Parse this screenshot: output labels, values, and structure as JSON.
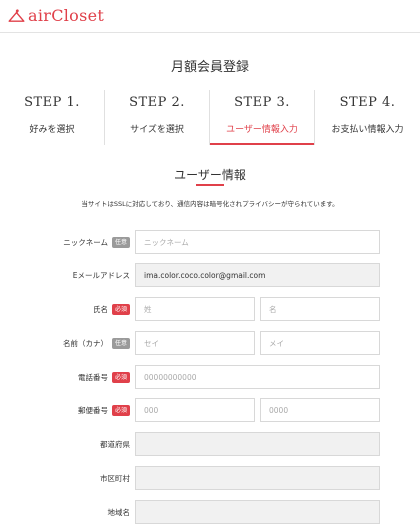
{
  "header": {
    "brand": "airCloset",
    "accent_color": "#e0404a",
    "logo_icon": "hanger-icon"
  },
  "page_title": "月額会員登録",
  "steps": [
    {
      "num": "STEP 1.",
      "label": "好みを選択",
      "active": false
    },
    {
      "num": "STEP 2.",
      "label": "サイズを選択",
      "active": false
    },
    {
      "num": "STEP 3.",
      "label": "ユーザー情報入力",
      "active": true
    },
    {
      "num": "STEP 4.",
      "label": "お支払い情報入力",
      "active": false
    }
  ],
  "section_title": "ユーザー情報",
  "notice": "当サイトはSSLに対応しており、通信内容は暗号化されプライバシーが守られています。",
  "badges": {
    "optional": "任意",
    "required": "必須"
  },
  "form": {
    "nickname": {
      "label": "ニックネーム",
      "placeholder": "ニックネーム"
    },
    "email": {
      "label": "Eメールアドレス",
      "value": "ima.color.coco.color@gmail.com"
    },
    "name": {
      "label": "氏名",
      "last_placeholder": "姓",
      "first_placeholder": "名"
    },
    "kana": {
      "label": "名前（カナ）",
      "last_placeholder": "セイ",
      "first_placeholder": "メイ"
    },
    "phone": {
      "label": "電話番号",
      "placeholder": "00000000000"
    },
    "postal": {
      "label": "郵便番号",
      "first_placeholder": "000",
      "second_placeholder": "0000"
    },
    "prefecture": {
      "label": "都道府県"
    },
    "city": {
      "label": "市区町村"
    },
    "area": {
      "label": "地域名"
    }
  }
}
